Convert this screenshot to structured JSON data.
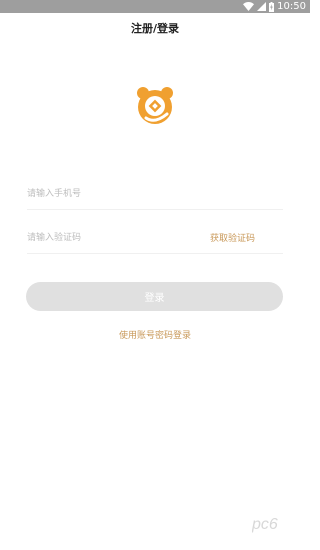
{
  "status_bar": {
    "time": "10:50",
    "icons": [
      "wifi-icon",
      "signal-icon",
      "battery-icon"
    ]
  },
  "header": {
    "title": "注册/登录"
  },
  "form": {
    "phone_placeholder": "请输入手机号",
    "code_placeholder": "请输入验证码",
    "get_code_label": "获取验证码",
    "login_label": "登录",
    "account_login_link": "使用账号密码登录"
  },
  "colors": {
    "accent": "#c9995a",
    "logo_orange": "#f0a030",
    "button_disabled": "#e0e0e0",
    "status_bar": "#9e9e9e"
  },
  "watermark": {
    "text": "pc6"
  }
}
